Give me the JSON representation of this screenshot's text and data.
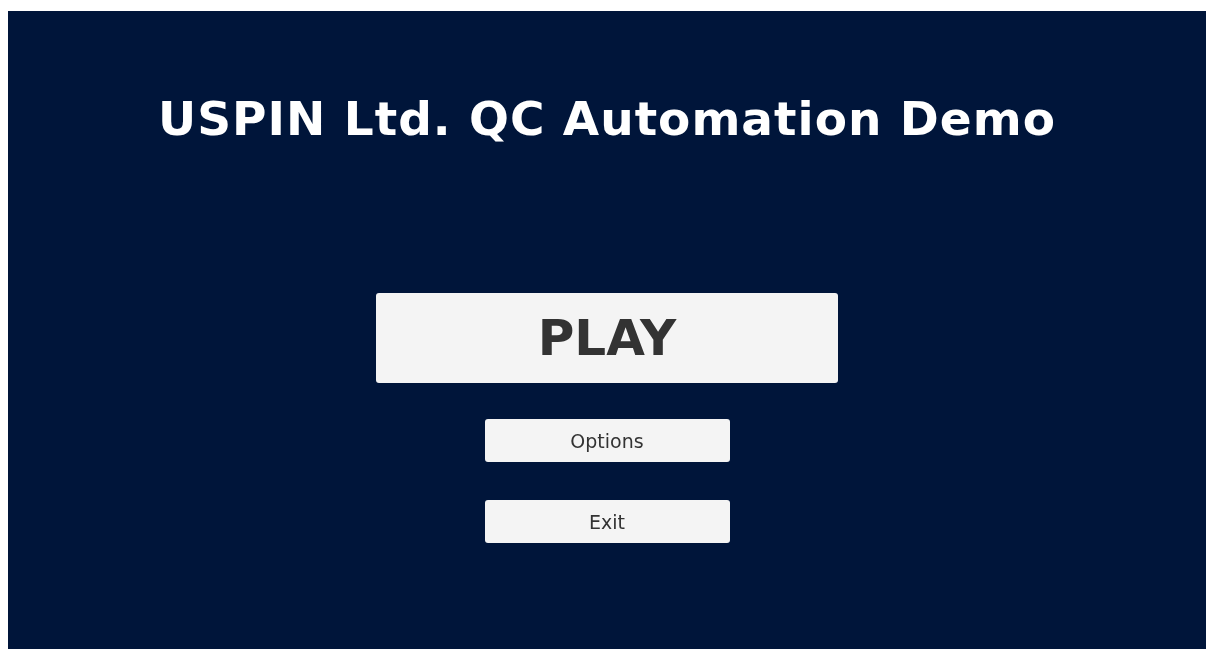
{
  "title": "USPIN Ltd. QC Automation Demo",
  "buttons": [
    {
      "label": "PLAY",
      "kind": "primary"
    },
    {
      "label": "Options",
      "kind": "secondary"
    },
    {
      "label": "Exit",
      "kind": "secondary"
    }
  ]
}
